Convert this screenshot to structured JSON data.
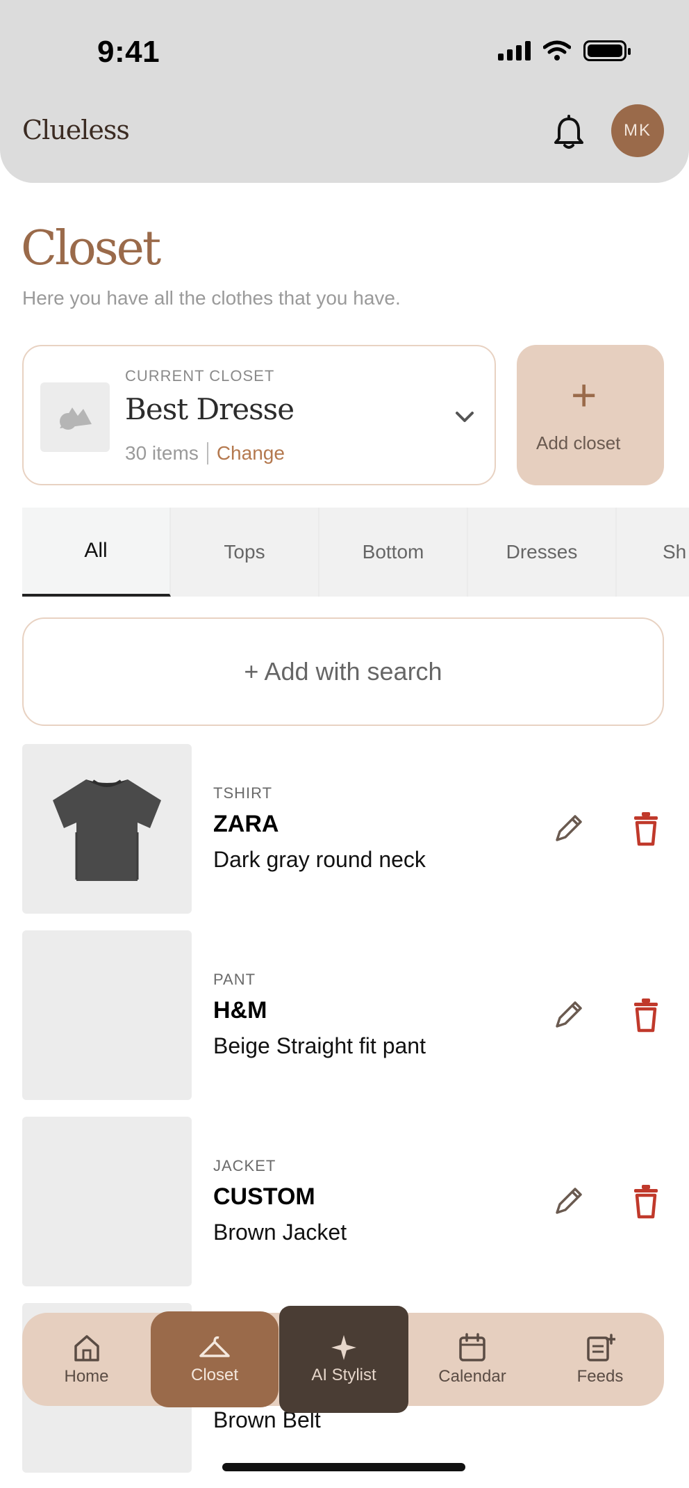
{
  "status_bar": {
    "time": "9:41"
  },
  "header": {
    "brand": "Clueless",
    "avatar_initials": "MK"
  },
  "page": {
    "title": "Closet",
    "subtitle": "Here you have all the clothes that you have."
  },
  "current_closet": {
    "label": "CURRENT CLOSET",
    "name": "Best Dresse",
    "count": "30 items",
    "change_label": "Change"
  },
  "add_closet": {
    "label": "Add closet"
  },
  "tabs": [
    {
      "label": "All"
    },
    {
      "label": "Tops"
    },
    {
      "label": "Bottom"
    },
    {
      "label": "Dresses"
    },
    {
      "label": "Sh"
    }
  ],
  "add_search": {
    "label": "+ Add with search"
  },
  "items": [
    {
      "type": "TSHIRT",
      "brand": "ZARA",
      "description": "Dark gray round neck"
    },
    {
      "type": "PANT",
      "brand": "H&M",
      "description": "Beige Straight fit pant"
    },
    {
      "type": "JACKET",
      "brand": "CUSTOM",
      "description": "Brown Jacket"
    },
    {
      "type": "",
      "brand": "",
      "description": "Brown Belt"
    }
  ],
  "bottom_nav": [
    {
      "label": "Home",
      "icon": "home-icon"
    },
    {
      "label": "Closet",
      "icon": "hanger-icon"
    },
    {
      "label": "AI Stylist",
      "icon": "sparkle-icon"
    },
    {
      "label": "Calendar",
      "icon": "calendar-icon"
    },
    {
      "label": "Feeds",
      "icon": "feeds-icon"
    }
  ],
  "colors": {
    "accent": "#9a6a4a",
    "accent_light": "#e6cfbf",
    "nav_dark": "#4a3d34",
    "delete": "#c0392b"
  }
}
